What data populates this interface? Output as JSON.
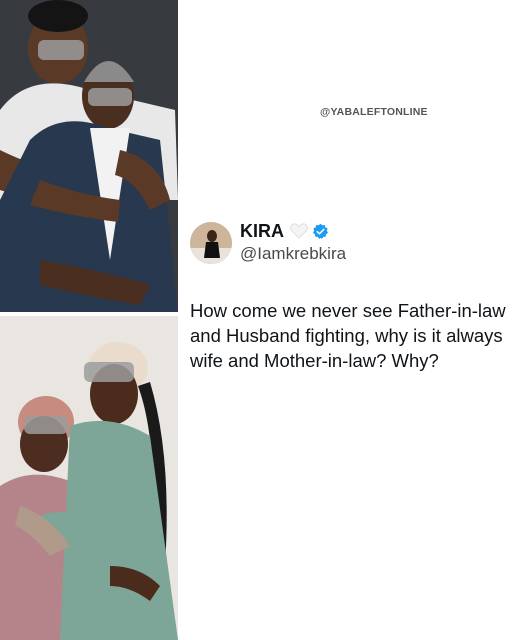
{
  "watermark": "@YABALEFTONLINE",
  "tweet": {
    "display_name": "KIRA",
    "handle": "@Iamkrebkira",
    "text": "How come we never see Father-in-law and Husband fighting, why is it always wife and Mother-in-law? Why?"
  },
  "icons": {
    "heart": "white-heart-icon",
    "verified": "verified-badge-icon"
  },
  "colors": {
    "verified_blue": "#1d9bf0",
    "text": "#0f1419",
    "handle": "#4a4a4a"
  }
}
